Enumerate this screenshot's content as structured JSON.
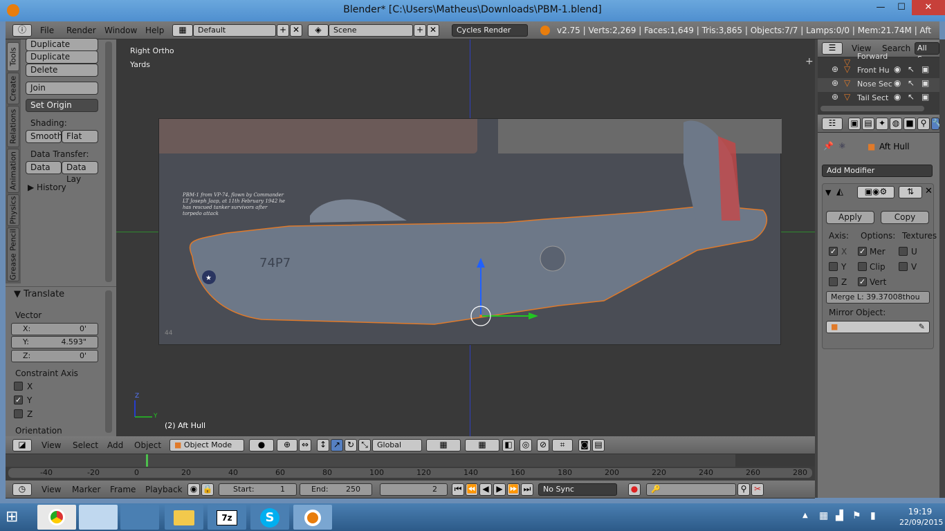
{
  "window": {
    "title": "Blender* [C:\\Users\\Matheus\\Downloads\\PBM-1.blend]",
    "minimize": "—",
    "maximize": "☐",
    "close": "✕"
  },
  "infobar": {
    "menus": [
      "File",
      "Render",
      "Window",
      "Help"
    ],
    "screen_layout": "Default",
    "scene": "Scene",
    "render_engine": "Cycles Render",
    "stats": "v2.75 | Verts:2,269 | Faces:1,649 | Tris:3,865 | Objects:7/7 | Lamps:0/0 | Mem:21.74M | Aft Hull"
  },
  "toolshelf": {
    "tabs": [
      "Tools",
      "Create",
      "Relations",
      "Animation",
      "Physics",
      "Grease Pencil"
    ],
    "buttons": {
      "duplicate": "Duplicate",
      "duplicate_linked": "Duplicate Linked",
      "delete": "Delete",
      "join": "Join",
      "set_origin": "Set Origin"
    },
    "shading_label": "Shading:",
    "smooth": "Smooth",
    "flat": "Flat",
    "data_transfer_label": "Data Transfer:",
    "data": "Data",
    "data_layout": "Data Lay",
    "history": "History"
  },
  "operator": {
    "title": "Translate",
    "vector_label": "Vector",
    "x": {
      "label": "X:",
      "value": "0'"
    },
    "y": {
      "label": "Y:",
      "value": "4.593\""
    },
    "z": {
      "label": "Z:",
      "value": "0'"
    },
    "constraint_label": "Constraint Axis",
    "axes": [
      {
        "label": "X",
        "checked": false
      },
      {
        "label": "Y",
        "checked": true
      },
      {
        "label": "Z",
        "checked": false
      }
    ],
    "orientation_label": "Orientation"
  },
  "viewport": {
    "view_name": "Right Ortho",
    "units": "Yards",
    "object_label": "(2) Aft Hull",
    "caption": "PBM-1 from VP-74, flown by Commander LT Joseph Jaap, at 11th February 1942 he has rescued tanker survivors after torpedo attack",
    "marking": "74P7",
    "page_number": "44",
    "axis_z": "Z",
    "axis_y": "Y"
  },
  "view3d_header": {
    "menus": [
      "View",
      "Select",
      "Add",
      "Object"
    ],
    "mode": "Object Mode",
    "orientation": "Global"
  },
  "outliner": {
    "menus": [
      "View",
      "Search"
    ],
    "filter": "All Sc",
    "items": [
      "Forward",
      "Front Hu",
      "Nose Sec",
      "Tail Sect"
    ]
  },
  "properties": {
    "breadcrumb_object": "Aft Hull",
    "add_modifier": "Add Modifier",
    "apply": "Apply",
    "copy": "Copy",
    "axis_label": "Axis:",
    "options_label": "Options:",
    "textures_label": "Textures",
    "axis_items": [
      {
        "label": "X",
        "checked": true
      },
      {
        "label": "Y",
        "checked": false
      },
      {
        "label": "Z",
        "checked": false
      }
    ],
    "option_items": [
      {
        "label": "Mer",
        "checked": true
      },
      {
        "label": "Clip",
        "checked": false
      },
      {
        "label": "Vert",
        "checked": true
      }
    ],
    "texture_items": [
      {
        "label": "U",
        "checked": false
      },
      {
        "label": "V",
        "checked": false
      }
    ],
    "merge_limit": "Merge L: 39.37008thou",
    "mirror_object_label": "Mirror Object:"
  },
  "timeline": {
    "ruler": [
      "-40",
      "-20",
      "0",
      "20",
      "40",
      "60",
      "80",
      "100",
      "120",
      "140",
      "160",
      "180",
      "200",
      "220",
      "240",
      "260",
      "280"
    ],
    "menus": [
      "View",
      "Marker",
      "Frame",
      "Playback"
    ],
    "start_label": "Start:",
    "start": "1",
    "end_label": "End:",
    "end": "250",
    "current": "2",
    "sync": "No Sync"
  },
  "taskbar": {
    "time": "19:19",
    "date": "22/09/2015"
  },
  "colors": {
    "accent_blue": "#5b9bd5",
    "hull_outline": "#e07a2a",
    "manipulator_blue": "#2060ff",
    "manipulator_green": "#22c522"
  }
}
